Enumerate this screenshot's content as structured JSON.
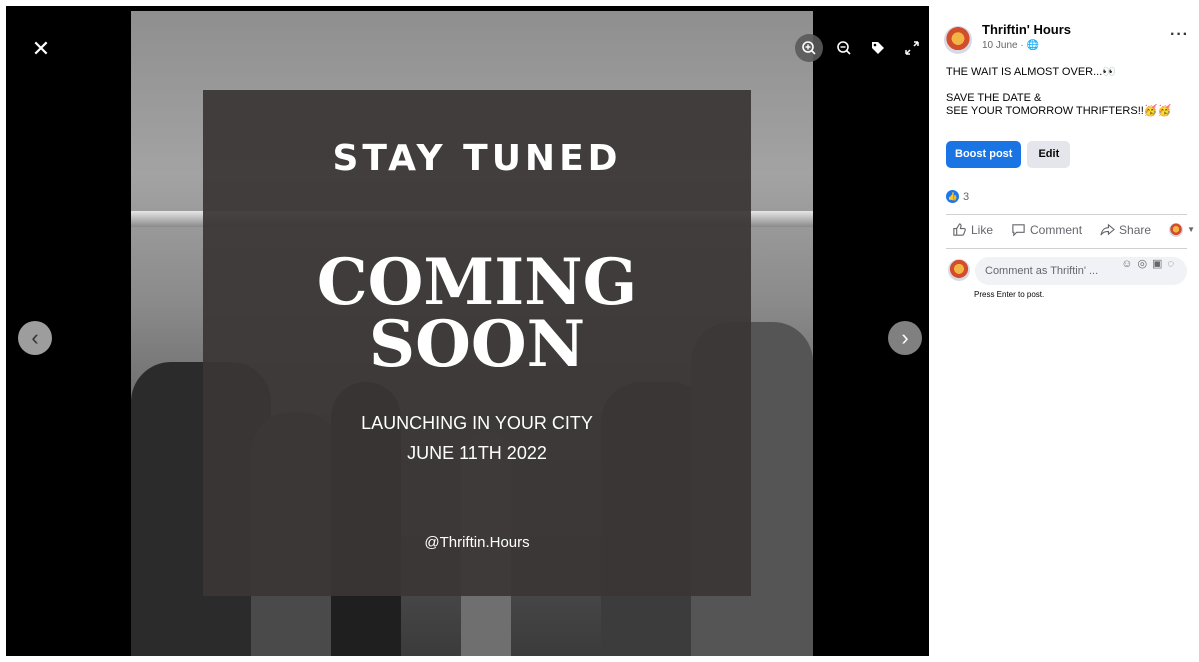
{
  "viewer": {
    "close_icon": "close-icon",
    "tools": [
      "zoom-in-icon",
      "zoom-out-icon",
      "tag-icon",
      "fullscreen-icon"
    ],
    "prev_icon": "chevron-left-icon",
    "next_icon": "chevron-right-icon",
    "photo": {
      "headline": "STAY TUNED",
      "title_line1": "COMING",
      "title_line2": "SOON",
      "subline1": "LAUNCHING IN YOUR CITY",
      "subline2": "JUNE 11TH 2022",
      "handle": "@Thriftin.Hours"
    }
  },
  "post": {
    "page_name": "Thriftin' Hours",
    "meta": "10 June · ",
    "text_lines": [
      "THE WAIT IS ALMOST OVER...👀",
      "",
      "SAVE THE DATE &",
      "SEE YOUR TOMORROW THRIFTERS!!🥳🥳"
    ],
    "boost_label": "Boost post",
    "edit_label": "Edit",
    "reaction_count": "3",
    "actions": {
      "like": "Like",
      "comment": "Comment",
      "share": "Share"
    },
    "comment_placeholder": "Comment as Thriftin' ...",
    "press_enter_hint": "Press Enter to post."
  },
  "colors": {
    "accent": "#1b74e4",
    "overlay": "#3a3636"
  }
}
